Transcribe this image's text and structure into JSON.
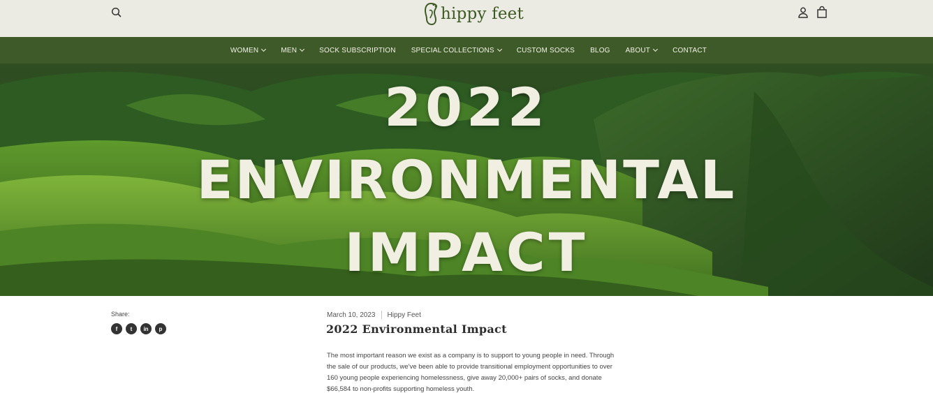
{
  "header": {
    "logo_text": "hippy feet",
    "icons": {
      "search": "search-icon",
      "account": "user-icon",
      "cart": "shopping-bag-icon"
    },
    "colors": {
      "topbar_bg": "#ecebe3",
      "brand_green": "#3d5a24"
    }
  },
  "nav": {
    "background": "#3e5a28",
    "items": [
      {
        "label": "WOMEN",
        "dropdown": true
      },
      {
        "label": "MEN",
        "dropdown": true
      },
      {
        "label": "SOCK SUBSCRIPTION",
        "dropdown": false
      },
      {
        "label": "SPECIAL COLLECTIONS",
        "dropdown": true
      },
      {
        "label": "CUSTOM SOCKS",
        "dropdown": false
      },
      {
        "label": "BLOG",
        "dropdown": false
      },
      {
        "label": "ABOUT",
        "dropdown": true
      },
      {
        "label": "CONTACT",
        "dropdown": false
      }
    ]
  },
  "hero": {
    "line1": "2022",
    "line2": "ENVIRONMENTAL",
    "line3": "IMPACT"
  },
  "share": {
    "label": "Share:",
    "icons": [
      {
        "name": "facebook-icon",
        "glyph": "f"
      },
      {
        "name": "twitter-icon",
        "glyph": "t"
      },
      {
        "name": "linkedin-icon",
        "glyph": "in"
      },
      {
        "name": "pinterest-icon",
        "glyph": "p"
      }
    ]
  },
  "article": {
    "date": "March 10, 2023",
    "author": "Hippy Feet",
    "title": "2022 Environmental Impact",
    "body": "The most important reason we exist as a company is to support to young people in need. Through the sale of our products, we've been able to provide transitional employment opportunities to over 160 young people experiencing homelessness, give away 20,000+ pairs of socks, and donate $66,584 to non-profits supporting homeless youth."
  }
}
